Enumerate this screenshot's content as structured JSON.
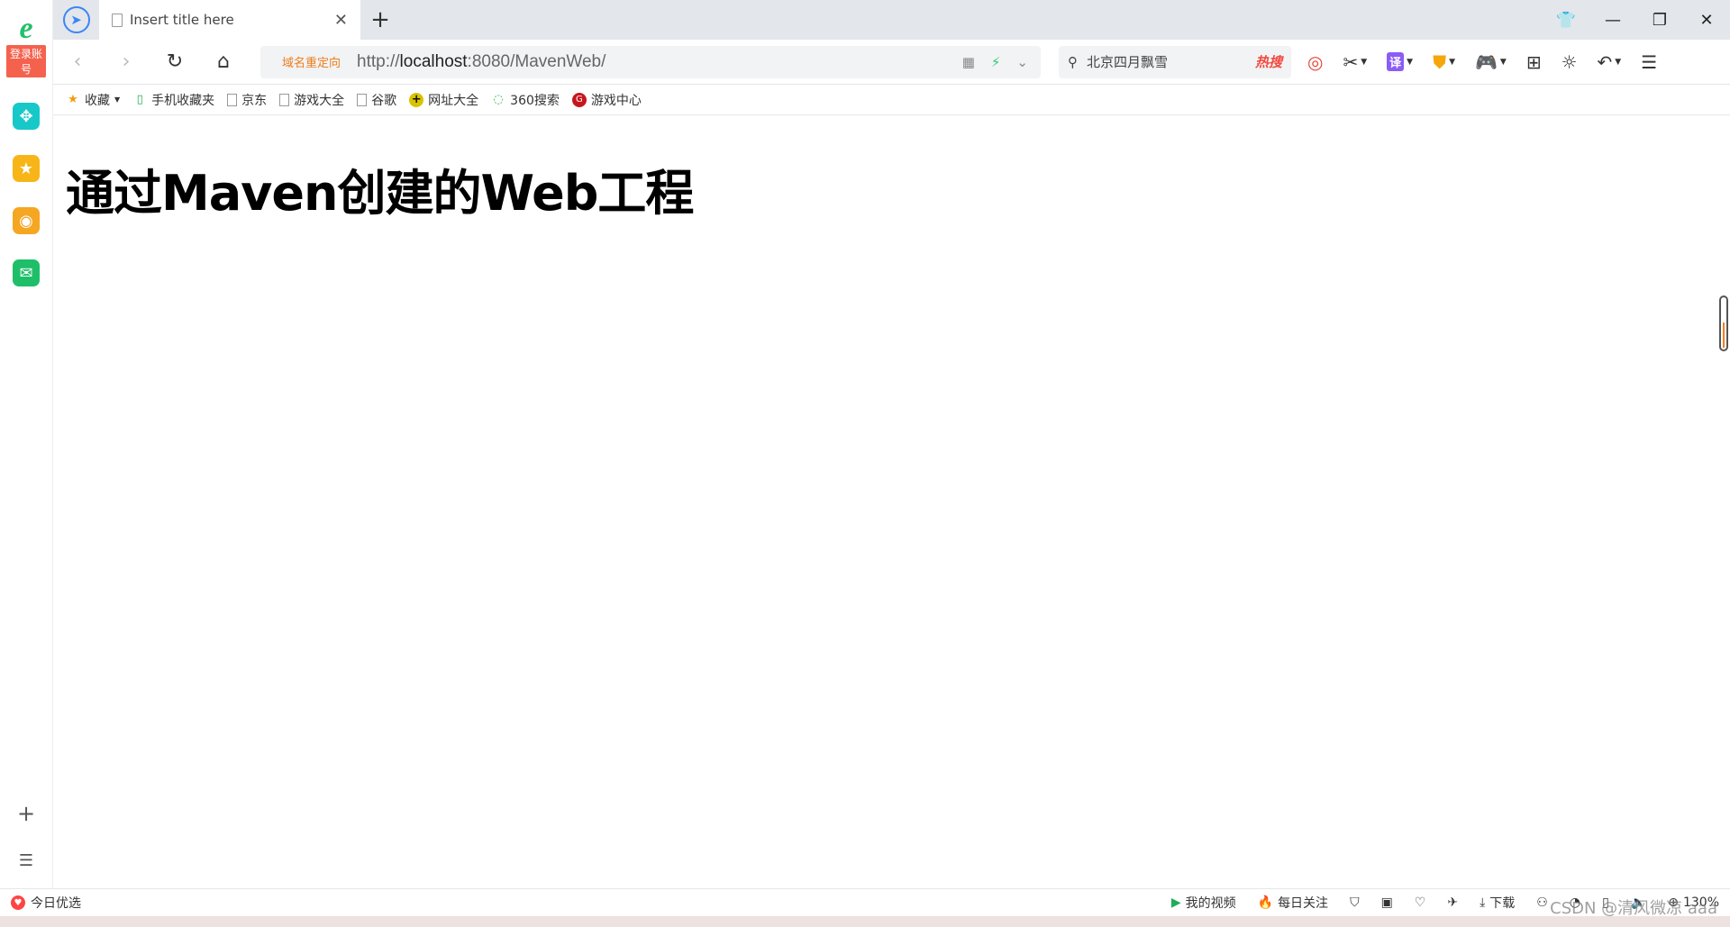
{
  "sidebar": {
    "login_label": "登录账号",
    "apps": [
      {
        "icon": "plugin-icon",
        "color": "#17c8c8"
      },
      {
        "icon": "star-icon",
        "color": "#f8b518"
      },
      {
        "icon": "weibo-icon",
        "color": "#f5a623"
      },
      {
        "icon": "mail-icon",
        "color": "#1fbf6a"
      }
    ]
  },
  "tab": {
    "title": "Insert title here"
  },
  "toolbar": {
    "redirect_label": "域名重定向",
    "url_prefix": "http://",
    "url_host": "localhost",
    "url_rest": ":8080/MavenWeb/",
    "search_text": "北京四月飘雪",
    "hot_label": "热搜"
  },
  "bookmarks": [
    {
      "label": "收藏",
      "icon": "star-icon"
    },
    {
      "label": "手机收藏夹",
      "icon": "phone-icon"
    },
    {
      "label": "京东",
      "icon": "page-icon"
    },
    {
      "label": "游戏大全",
      "icon": "page-icon"
    },
    {
      "label": "谷歌",
      "icon": "page-icon"
    },
    {
      "label": "网址大全",
      "icon": "plus-circle-icon"
    },
    {
      "label": "360搜索",
      "icon": "360-icon"
    },
    {
      "label": "游戏中心",
      "icon": "game-icon"
    }
  ],
  "page": {
    "heading": "通过Maven创建的Web工程"
  },
  "status": {
    "today_label": "今日优选",
    "video_label": "我的视频",
    "daily_label": "每日关注",
    "download_label": "下载",
    "zoom": "130%"
  },
  "watermark": "CSDN @清风微凉 aaa"
}
